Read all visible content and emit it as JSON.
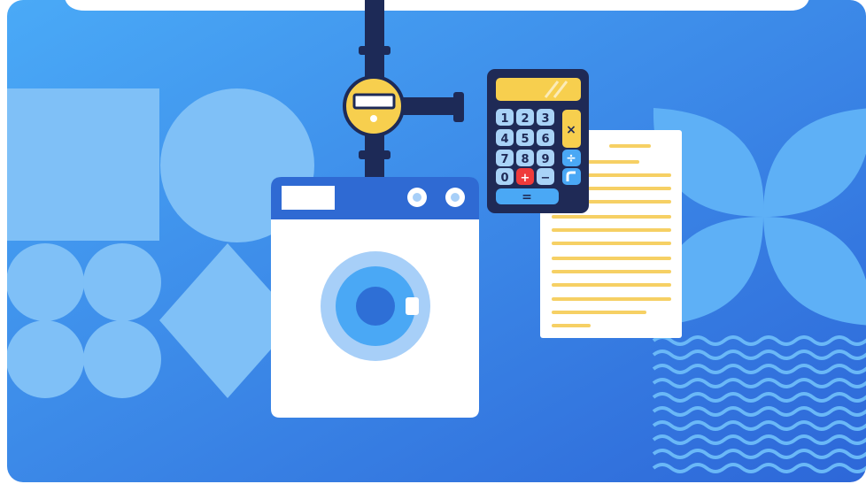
{
  "scene": {
    "description_type": "flat illustration",
    "colors": {
      "bg_light": "#4aaaf7",
      "bg_dark": "#2d67d8",
      "shape_light": "#7fc0f7",
      "pipe": "#1d2a57",
      "meter_yellow": "#f7cf4e",
      "washer_top": "#2f6ad3",
      "washer_body": "#ffffff",
      "drum_outer": "#a7cff8",
      "drum_mid": "#4aa8f5",
      "drum_inner": "#2e6fd6",
      "calculator_body": "#1f2a56",
      "calculator_key": "#a9d3f7",
      "calculator_red": "#ef3b3b",
      "calculator_blue": "#4aa8f5",
      "doc_line": "#f6d064",
      "wave": "#6ab8f7"
    },
    "icons": {
      "meter": "water-meter-icon",
      "washer": "washing-machine-icon",
      "calculator": "calculator-icon",
      "document": "document-icon"
    },
    "calculator": {
      "keys": [
        "1",
        "2",
        "3",
        "4",
        "5",
        "6",
        "7",
        "8",
        "9",
        "0",
        "+",
        "−",
        "="
      ],
      "operators": [
        "×",
        "÷"
      ]
    }
  }
}
